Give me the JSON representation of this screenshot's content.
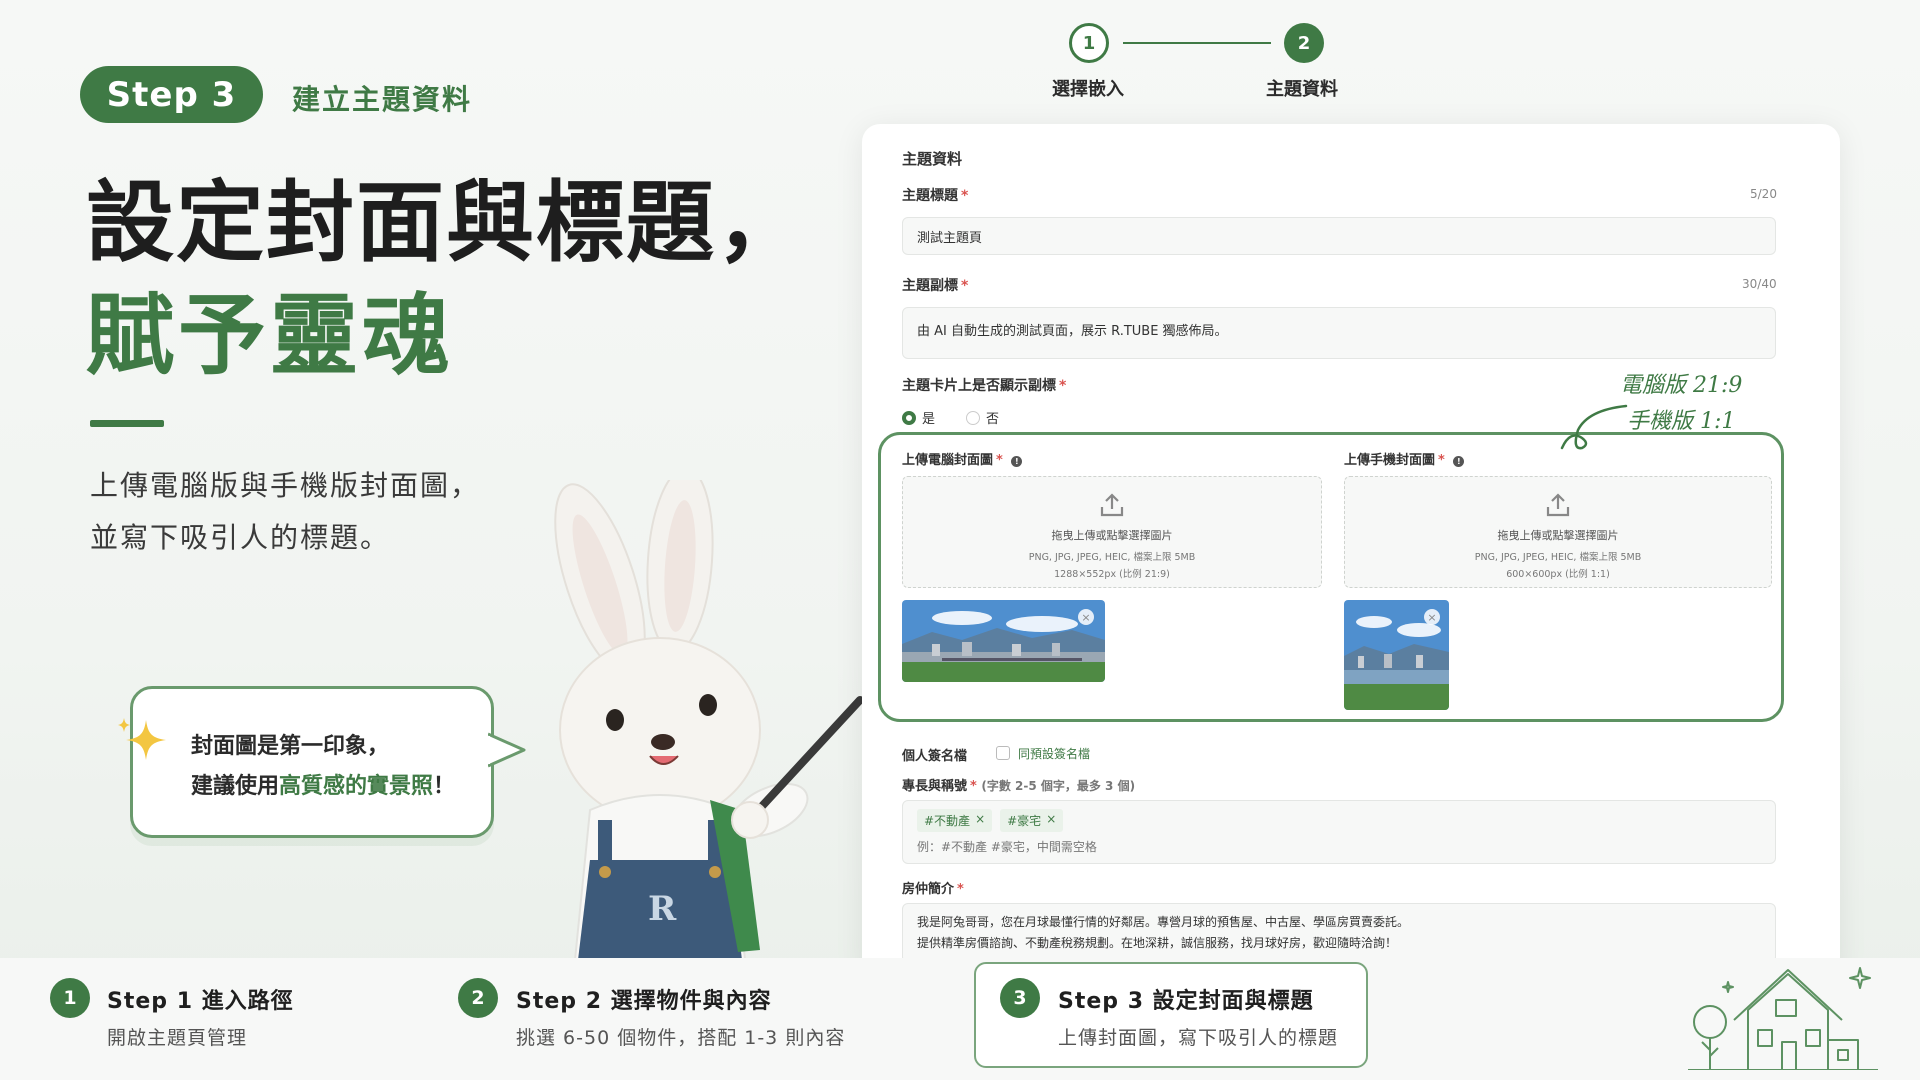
{
  "header": {
    "step_pill": "Step 3",
    "step_subtitle": "建立主題資料"
  },
  "hero": {
    "line1": "設定封面與標題，",
    "line2": "賦予靈魂",
    "desc_line1": "上傳電腦版與手機版封面圖，",
    "desc_line2": "並寫下吸引人的標題。"
  },
  "bubble": {
    "line1": "封面圖是第一印象，",
    "line2_prefix": "建議使用",
    "line2_highlight": "高質感的實景照",
    "line2_suffix": "！"
  },
  "stepper": {
    "steps": [
      {
        "num": "1",
        "label": "選擇嵌入"
      },
      {
        "num": "2",
        "label": "主題資料"
      }
    ]
  },
  "form": {
    "section_title": "主題資料",
    "title_label": "主題標題",
    "title_counter": "5/20",
    "title_value": "測試主題頁",
    "subtitle_label": "主題副標",
    "subtitle_counter": "30/40",
    "subtitle_value": "由 AI 自動生成的測試頁面，展示 R.TUBE 獨感佈局。",
    "show_subtitle_label": "主題卡片上是否顯示副標",
    "radio_yes": "是",
    "radio_no": "否",
    "ratio_note_1": "電腦版 21:9",
    "ratio_note_2": "手機版 1:1",
    "desktop_cover_label": "上傳電腦封面圖",
    "mobile_cover_label": "上傳手機封面圖",
    "upload_text": "拖曳上傳或點擊選擇圖片",
    "upload_formats": "PNG, JPG, JPEG, HEIC, 檔案上限 5MB",
    "desktop_size": "1288×552px (比例 21:9)",
    "mobile_size": "600×600px (比例 1:1)",
    "signature_label": "個人簽名檔",
    "signature_checkbox": "同預設簽名檔",
    "specialty_label": "專長與稱號",
    "specialty_hint": "(字數 2-5 個字，最多 3 個)",
    "tags": [
      "#不動產",
      "#豪宅"
    ],
    "specialty_placeholder": "例：#不動產 #豪宅，中間需空格",
    "bio_label": "房仲簡介",
    "bio_line1": "我是阿兔哥哥，您在月球最懂行情的好鄰居。專營月球的預售屋、中古屋、學區房買賣委託。",
    "bio_line2": "提供精準房價諮詢、不動產稅務規劃。在地深耕，誠信服務，找月球好房，歡迎隨時洽詢！"
  },
  "bottom": {
    "steps": [
      {
        "num": "1",
        "title": "Step 1  進入路徑",
        "sub": "開啟主題頁管理"
      },
      {
        "num": "2",
        "title": "Step 2  選擇物件與內容",
        "sub": "挑選 6-50 個物件，搭配 1-3 則內容"
      },
      {
        "num": "3",
        "title": "Step 3  設定封面與標題",
        "sub": "上傳封面圖，寫下吸引人的標題"
      }
    ]
  },
  "colors": {
    "brand_green": "#3f7a45",
    "required_red": "#d9534f"
  }
}
